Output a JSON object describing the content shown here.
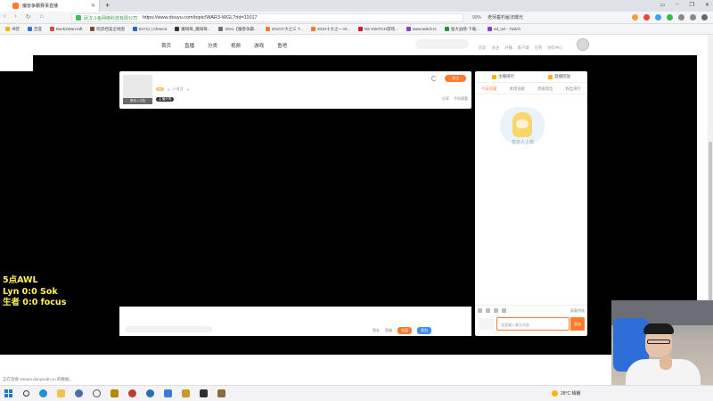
{
  "browser": {
    "tab_title": "魔兽争霸赛事直播",
    "new_tab_symbol": "+",
    "window_controls": [
      "▭",
      "–",
      "❐",
      "✕"
    ],
    "nav_symbols": [
      "‹",
      "›",
      "↻",
      "⌂"
    ],
    "cert_owner": "武汉斗鱼网络科技有限公司",
    "url": "https://www.douyu.com/topic/WAR3-WGL?rid=11017",
    "zoom": "90%",
    "promo_text": "老师垂钓秘法曝光"
  },
  "bookmarks": [
    {
      "label": "书签",
      "color": "#f2b400"
    },
    {
      "label": "百度",
      "color": "#3b6fd8"
    },
    {
      "label": "Back2Warcraft",
      "color": "#d84c3b"
    },
    {
      "label": "暗黑档案全地图",
      "color": "#7a4b2c"
    },
    {
      "label": "BJ711 | Afreeca",
      "color": "#2d62c9"
    },
    {
      "label": "魔域每_魔域每...",
      "color": "#333"
    },
    {
      "label": "2021【魔兽争霸...",
      "color": "#6e6e6e"
    },
    {
      "label": "2010十大之三 T...",
      "color": "#ff7a2d"
    },
    {
      "label": "2010十大之一 M...",
      "color": "#ff7a2d"
    },
    {
      "label": "NS SWITCH游戏...",
      "color": "#d61d1d"
    },
    {
      "label": "www.twitch.tv",
      "color": "#8a3dcc"
    },
    {
      "label": "强大战绩-下载...",
      "color": "#2a8f3a"
    },
    {
      "label": "ed_ucl - Twitch",
      "color": "#8a3dcc"
    }
  ],
  "site": {
    "nav": [
      "首页",
      "直播",
      "分类",
      "视频",
      "游戏",
      "鱼吧"
    ],
    "links": [
      "历史",
      "关注",
      "开播",
      "客户端",
      "任务",
      "创作中心"
    ]
  },
  "room": {
    "thumb_label": "首页 | 公告",
    "level_tag": "LV.",
    "stats": [
      "0",
      "0 关注",
      "0"
    ],
    "badge": "主播分类",
    "follow_label": "关注",
    "actions": [
      "分享",
      "手机观看"
    ]
  },
  "chat": {
    "tools": [
      "鱼丸",
      "鱼翅"
    ],
    "btn_orange": "充值",
    "btn_blue": "背包"
  },
  "panel": {
    "top_items": [
      "主播排行",
      "直播回放"
    ],
    "tabs": [
      "今日贡献",
      "本周贡献",
      "贵族席位",
      "粉丝排行"
    ],
    "empty_text": "暂无人上榜",
    "tools_right": "屏蔽特效",
    "input_placeholder": "这里输入聊天内容",
    "send_label": "发送"
  },
  "scoreboard": {
    "line1": "5点AWL",
    "line2": "Lyn 0:0 Sok",
    "line3": "生者 0:0 focus"
  },
  "status": {
    "text": "正在连接 stream.douyucdn.cn 的数据..."
  },
  "taskbar": {
    "weather": "28°C 晴朗"
  }
}
